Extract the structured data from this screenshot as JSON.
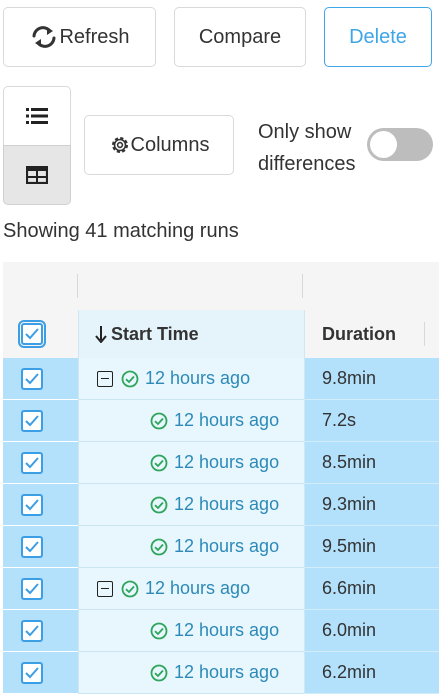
{
  "toolbar": {
    "refresh_label": "Refresh",
    "compare_label": "Compare",
    "delete_label": "Delete",
    "columns_label": "Columns",
    "only_show_differences_label": "Only show differences",
    "only_show_differences_on": false
  },
  "view_mode": {
    "options": [
      "list",
      "table"
    ],
    "selected": "table"
  },
  "summary": {
    "count_text": "Showing 41 matching runs"
  },
  "table": {
    "columns": [
      "Start Time",
      "Duration"
    ],
    "sort_column": "Start Time",
    "header_checkbox_checked": true,
    "rows": [
      {
        "start_time": "12 hours ago",
        "duration": "9.8min",
        "is_parent": true,
        "checked": true
      },
      {
        "start_time": "12 hours ago",
        "duration": "7.2s",
        "is_parent": false,
        "checked": true
      },
      {
        "start_time": "12 hours ago",
        "duration": "8.5min",
        "is_parent": false,
        "checked": true
      },
      {
        "start_time": "12 hours ago",
        "duration": "9.3min",
        "is_parent": false,
        "checked": true
      },
      {
        "start_time": "12 hours ago",
        "duration": "9.5min",
        "is_parent": false,
        "checked": true
      },
      {
        "start_time": "12 hours ago",
        "duration": "6.6min",
        "is_parent": true,
        "checked": true
      },
      {
        "start_time": "12 hours ago",
        "duration": "6.0min",
        "is_parent": false,
        "checked": true
      },
      {
        "start_time": "12 hours ago",
        "duration": "6.2min",
        "is_parent": false,
        "checked": true
      }
    ]
  },
  "colors": {
    "accent": "#3fa6e8",
    "selected_row": "#b3e0fa",
    "status_ok": "#2ea55a",
    "link_text": "#2d8ab8"
  },
  "icons": {
    "refresh": "refresh-icon",
    "list_view": "list-icon",
    "table_view": "table-icon",
    "columns": "gear-icon",
    "sort": "arrow-down-icon",
    "collapse": "minus-square-icon",
    "status": "check-circle-icon"
  }
}
